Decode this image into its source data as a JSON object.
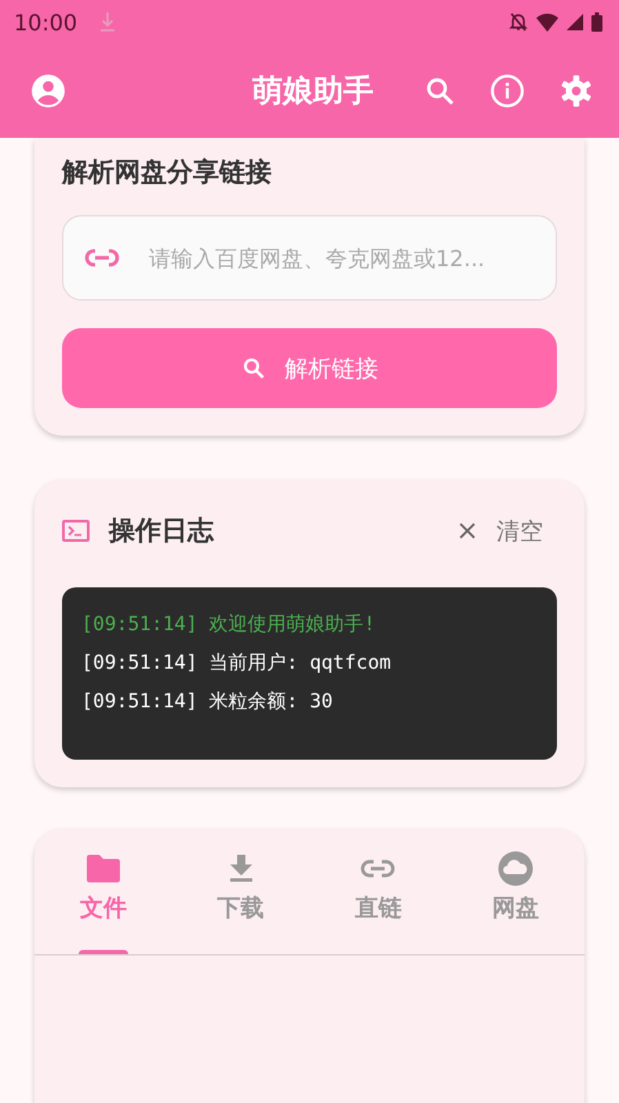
{
  "status_bar": {
    "time": "10:00"
  },
  "app_bar": {
    "title": "萌娘助手"
  },
  "parse_card": {
    "title": "解析网盘分享链接",
    "input": {
      "placeholder": "请输入百度网盘、夸克网盘或12..."
    },
    "button": "解析链接"
  },
  "log_card": {
    "title": "操作日志",
    "clear": "清空",
    "lines": [
      {
        "text": "[09:51:14] 欢迎使用萌娘助手!",
        "color": "#4caf50"
      },
      {
        "text": "[09:51:14] 当前用户: qqtfcom",
        "color": "#ffffff"
      },
      {
        "text": "[09:51:14] 米粒余额: 30",
        "color": "#ffffff"
      }
    ]
  },
  "tabs": [
    {
      "label": "文件",
      "kind": "folder",
      "selected": true
    },
    {
      "label": "下载",
      "kind": "download",
      "selected": false
    },
    {
      "label": "直链",
      "kind": "link",
      "selected": false
    },
    {
      "label": "网盘",
      "kind": "cloud",
      "selected": false
    }
  ]
}
